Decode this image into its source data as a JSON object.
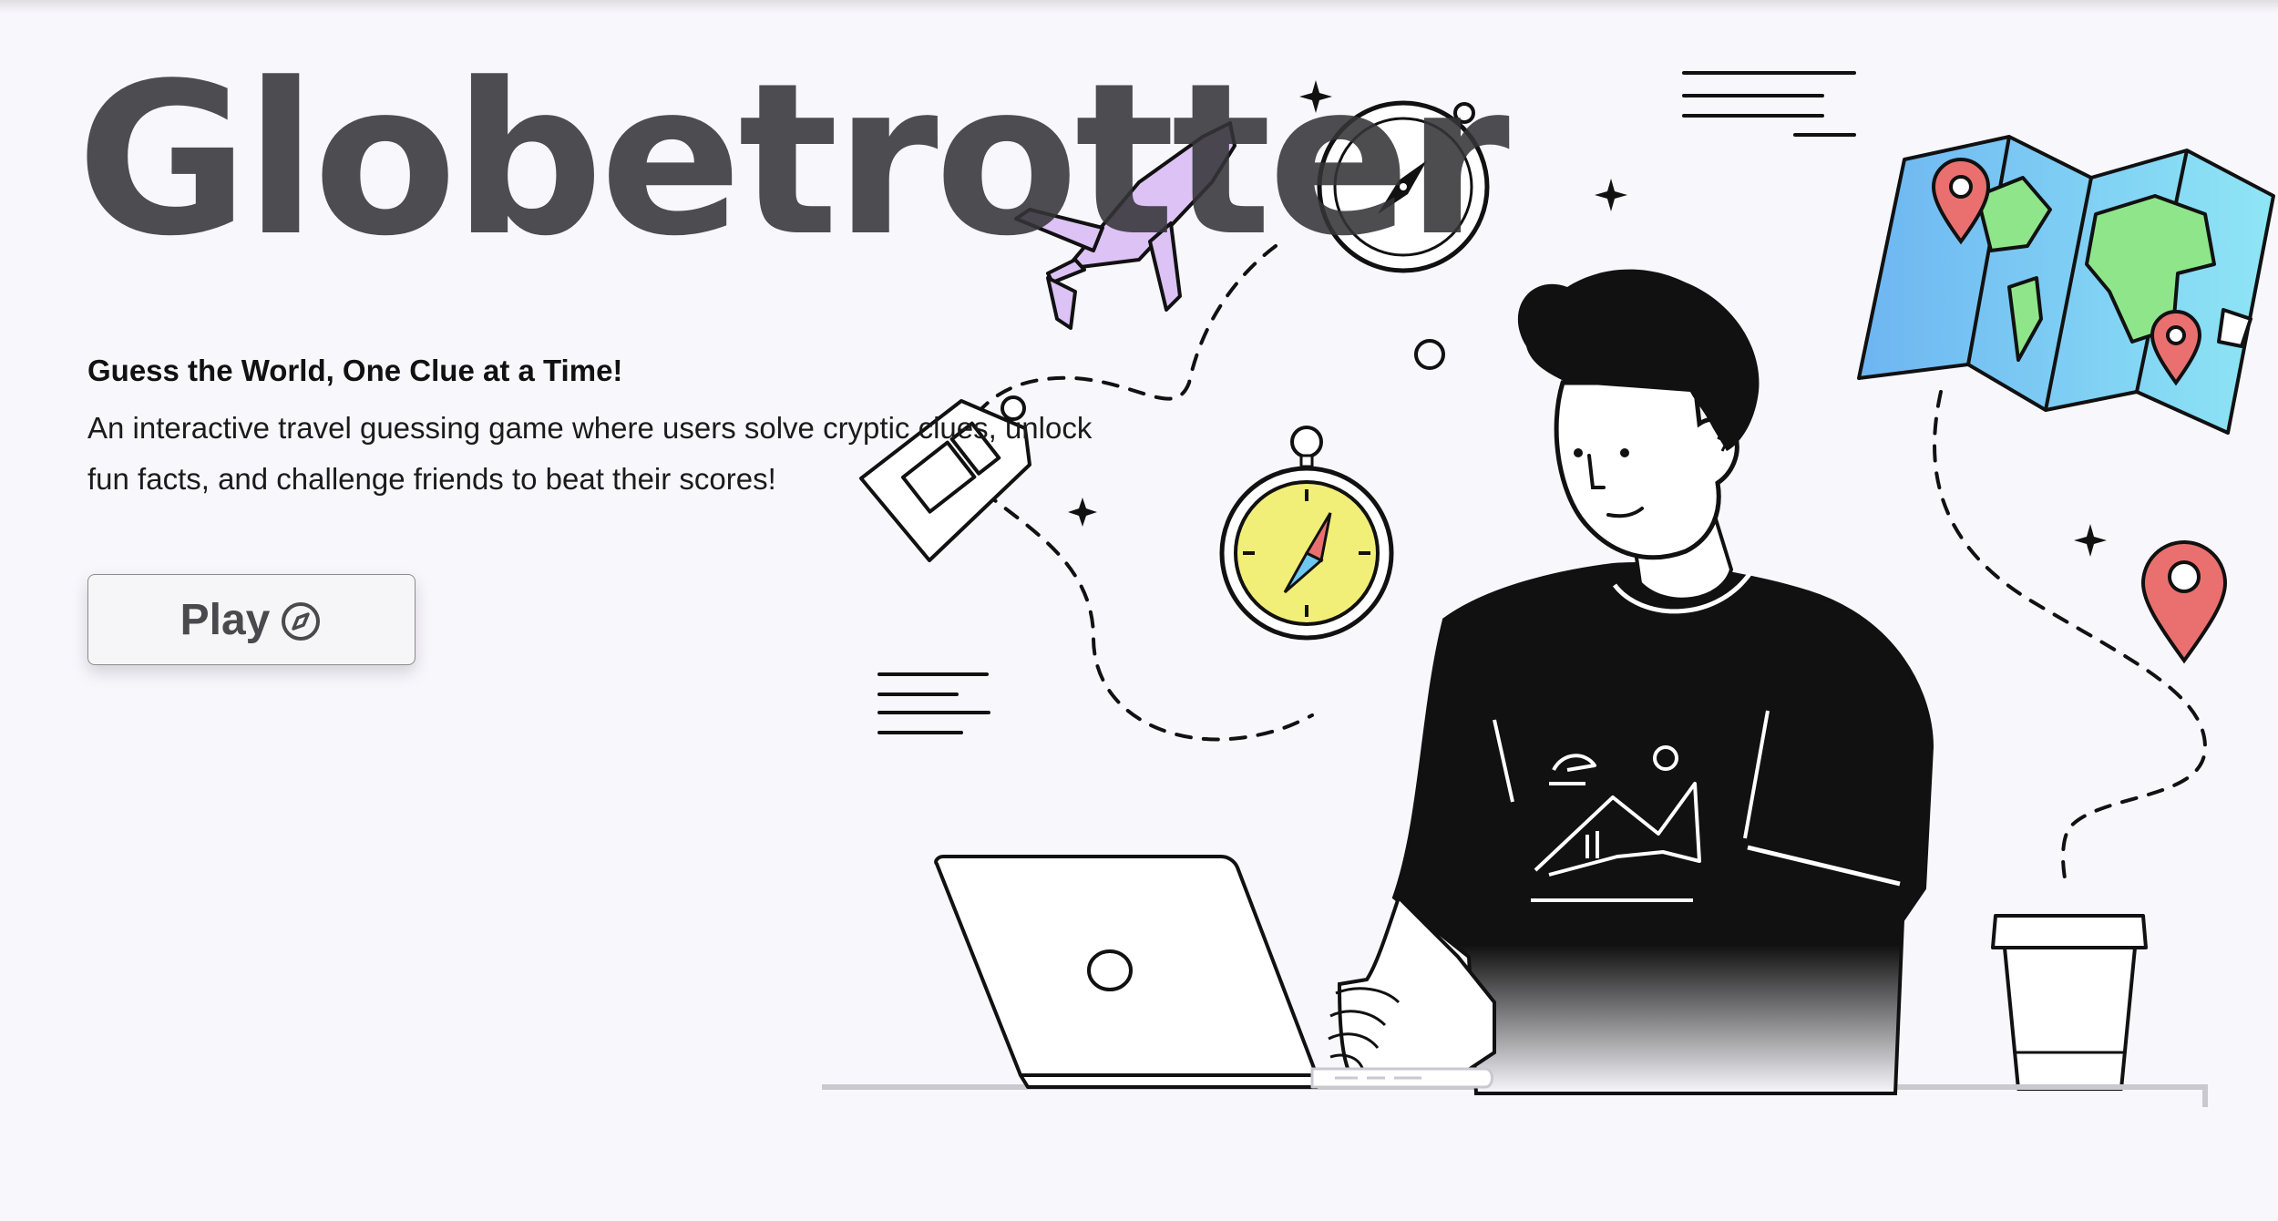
{
  "hero": {
    "title": "Globetrotter",
    "tagline": "Guess the World, One Clue at a Time!",
    "description": "An interactive travel guessing game where users solve cryptic clues, unlock fun facts, and challenge friends to beat their scores!"
  },
  "play_button": {
    "label": "Play",
    "icon": "compass-icon"
  },
  "illustration": {
    "subject": "person-with-laptop",
    "colors": {
      "background": "#f8f7fc",
      "ink": "#111111",
      "plane": "#dcc2f5",
      "compass_face": "#f2ef78",
      "map_blue": "#6db5f2",
      "map_cyan": "#8fe6f5",
      "map_green": "#8fe68a",
      "pin_red": "#ea7070"
    }
  }
}
